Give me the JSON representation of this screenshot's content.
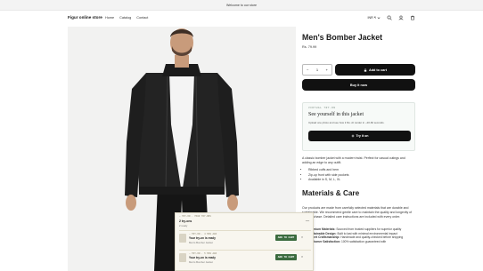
{
  "announcement": "Welcome to our store",
  "header": {
    "logo": "Figur online store",
    "nav": [
      "Home",
      "Catalog",
      "Contact"
    ],
    "currency": "INR ₹",
    "icons": [
      "search-icon",
      "account-icon",
      "cart-icon"
    ]
  },
  "product": {
    "title": "Men's Bomber Jacket",
    "price": "Rs. 79.99",
    "quantity": "1",
    "add_to_cart": "Add to cart",
    "buy_now": "Buy it now",
    "tryon": {
      "eyebrow": "VIRTUAL TRY-ON",
      "heading": "See yourself in this jacket",
      "sub": "Upload one photo and see how it fits. AI render in ~20-60 seconds.",
      "button": "Try it on"
    },
    "description": "A classic bomber jacket with a modern twist. Perfect for casual outings and adding an edge to any outfit.",
    "bullets": [
      "Ribbed cuffs and hem",
      "Zip-up front with side pockets",
      "Available in S, M, L, XL"
    ],
    "materials_title": "Materials & Care",
    "materials_text": "Our products are made from carefully selected materials that are durable and sustainable. We recommend gentle care to maintain the quality and longevity of your purchase. Detailed care instructions are included with every order.",
    "materials_list": [
      {
        "label": "Premium Materials:",
        "text": "Sourced from trusted suppliers for superior quality"
      },
      {
        "label": "Sustainable Design:",
        "text": "Built to last with minimal environmental impact"
      },
      {
        "label": "Expert Craftsmanship:",
        "text": "Handmade and quality-checked before shipping"
      },
      {
        "label": "Customer Satisfaction:",
        "text": "100% satisfaction guaranteed with"
      }
    ]
  },
  "overlay": {
    "eyebrow": "— TRY-ON · YOUR TRY-ONS",
    "title": "2 try-ons",
    "count": "2 ready",
    "close": "—",
    "items": [
      {
        "meta": "— TRY-ON · 4 MIN AGO",
        "text": "Your try-on is ready",
        "sub": "Men's Bomber Jacket",
        "add": "ADD TO CART",
        "x": "×"
      },
      {
        "meta": "— TRY-ON · 5 MIN AGO",
        "text": "Your try-on is ready",
        "sub": "Men's Bomber Jacket",
        "add": "ADD TO CART",
        "x": "×"
      }
    ]
  }
}
